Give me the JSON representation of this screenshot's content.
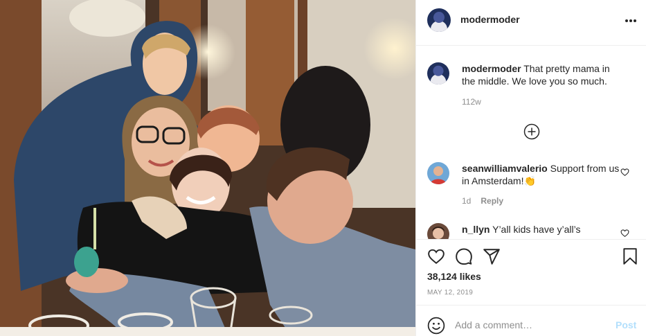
{
  "post": {
    "username": "modermoder",
    "caption_username": "modermoder",
    "caption_text": "That pretty mama in the middle. We love you so much.",
    "caption_age": "112w",
    "more_icon": "more-dots-icon",
    "load_more_icon": "plus-circle-icon"
  },
  "comments": [
    {
      "username": "seanwilliamvalerio",
      "text": "Support from us in Amsterdam!👏",
      "age": "1d",
      "reply_label": "Reply"
    },
    {
      "username": "n_llyn",
      "text": "Y’all kids have y’all’s"
    }
  ],
  "actions": {
    "like_icon": "heart-icon",
    "comment_icon": "comment-icon",
    "share_icon": "share-icon",
    "save_icon": "bookmark-icon",
    "likes": "38,124 likes",
    "date": "MAY 12, 2019"
  },
  "compose": {
    "emoji_icon": "emoji-icon",
    "placeholder": "Add a comment…",
    "post_label": "Post"
  },
  "colors": {
    "text": "#262626",
    "muted": "#8e8e8e",
    "post_button_disabled": "#b2dffc",
    "divider": "#efefef"
  }
}
